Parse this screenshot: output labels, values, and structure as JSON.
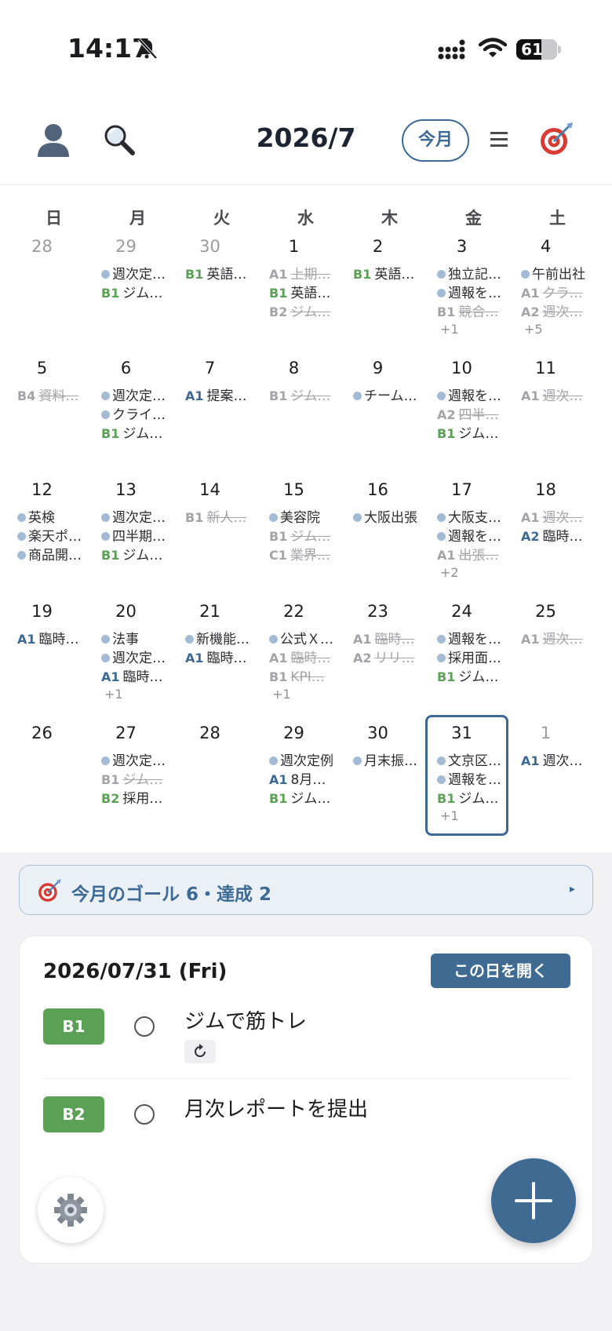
{
  "status_bar": {
    "time": "14:17",
    "battery": "61",
    "battery_level": 0.61
  },
  "header": {
    "month_title": "2026/7",
    "today_label": "今月"
  },
  "weekdays": [
    "日",
    "月",
    "火",
    "水",
    "木",
    "金",
    "土"
  ],
  "calendar": {
    "days": [
      {
        "num": "28",
        "muted": true,
        "events": []
      },
      {
        "num": "29",
        "muted": true,
        "events": [
          {
            "text": "週次定…"
          },
          {
            "tag": "B1",
            "text": "ジム…"
          }
        ]
      },
      {
        "num": "30",
        "muted": true,
        "events": [
          {
            "tag": "B1",
            "text": "英語…"
          }
        ]
      },
      {
        "num": "1",
        "events": [
          {
            "tag": "A1",
            "text": "上期…",
            "done": true
          },
          {
            "tag": "B1",
            "text": "英語…"
          },
          {
            "tag": "B2",
            "text": "ジム…",
            "done": true
          }
        ]
      },
      {
        "num": "2",
        "events": [
          {
            "tag": "B1",
            "text": "英語…"
          }
        ]
      },
      {
        "num": "3",
        "events": [
          {
            "text": "独立記…"
          },
          {
            "text": "週報を…"
          },
          {
            "tag": "B1",
            "text": "競合…",
            "done": true
          }
        ],
        "more": "+1"
      },
      {
        "num": "4",
        "events": [
          {
            "text": "午前出社"
          },
          {
            "tag": "A1",
            "text": "クラ…",
            "done": true
          },
          {
            "tag": "A2",
            "text": "週次…",
            "done": true
          }
        ],
        "more": "+5"
      },
      {
        "num": "5",
        "events": [
          {
            "tag": "B4",
            "text": "資料…",
            "done": true
          }
        ]
      },
      {
        "num": "6",
        "events": [
          {
            "text": "週次定…"
          },
          {
            "text": "クライ…"
          },
          {
            "tag": "B1",
            "text": "ジム…"
          }
        ]
      },
      {
        "num": "7",
        "events": [
          {
            "tag": "A1",
            "text": "提案…"
          }
        ]
      },
      {
        "num": "8",
        "events": [
          {
            "tag": "B1",
            "text": "ジム…",
            "done": true
          }
        ]
      },
      {
        "num": "9",
        "events": [
          {
            "text": "チーム…"
          }
        ]
      },
      {
        "num": "10",
        "events": [
          {
            "text": "週報を…"
          },
          {
            "tag": "A2",
            "text": "四半…",
            "done": true
          },
          {
            "tag": "B1",
            "text": "ジム…"
          }
        ]
      },
      {
        "num": "11",
        "events": [
          {
            "tag": "A1",
            "text": "週次…",
            "done": true
          }
        ]
      },
      {
        "num": "12",
        "events": [
          {
            "text": "英検"
          },
          {
            "text": "楽天ポ…"
          },
          {
            "text": "商品開…"
          }
        ]
      },
      {
        "num": "13",
        "events": [
          {
            "text": "週次定…"
          },
          {
            "text": "四半期…"
          },
          {
            "tag": "B1",
            "text": "ジム…"
          }
        ]
      },
      {
        "num": "14",
        "events": [
          {
            "tag": "B1",
            "text": "新人…",
            "done": true
          }
        ]
      },
      {
        "num": "15",
        "events": [
          {
            "text": "美容院"
          },
          {
            "tag": "B1",
            "text": "ジム…",
            "done": true
          },
          {
            "tag": "C1",
            "text": "業界…",
            "done": true
          }
        ]
      },
      {
        "num": "16",
        "events": [
          {
            "text": "大阪出張"
          }
        ]
      },
      {
        "num": "17",
        "events": [
          {
            "text": "大阪支…"
          },
          {
            "text": "週報を…"
          },
          {
            "tag": "A1",
            "text": "出張…",
            "done": true
          }
        ],
        "more": "+2"
      },
      {
        "num": "18",
        "events": [
          {
            "tag": "A1",
            "text": "週次…",
            "done": true
          },
          {
            "tag": "A2",
            "text": "臨時…"
          }
        ]
      },
      {
        "num": "19",
        "events": [
          {
            "tag": "A1",
            "text": "臨時…"
          }
        ]
      },
      {
        "num": "20",
        "events": [
          {
            "text": "法事"
          },
          {
            "text": "週次定…"
          },
          {
            "tag": "A1",
            "text": "臨時…"
          }
        ],
        "more": "+1"
      },
      {
        "num": "21",
        "events": [
          {
            "text": "新機能…"
          },
          {
            "tag": "A1",
            "text": "臨時…"
          }
        ]
      },
      {
        "num": "22",
        "events": [
          {
            "text": "公式Ｘ…"
          },
          {
            "tag": "A1",
            "text": "臨時…",
            "done": true
          },
          {
            "tag": "B1",
            "text": "KPI…",
            "done": true
          }
        ],
        "more": "+1"
      },
      {
        "num": "23",
        "events": [
          {
            "tag": "A1",
            "text": "臨時…",
            "done": true
          },
          {
            "tag": "A2",
            "text": "リリ…",
            "done": true
          }
        ]
      },
      {
        "num": "24",
        "events": [
          {
            "text": "週報を…"
          },
          {
            "text": "採用面…"
          },
          {
            "tag": "B1",
            "text": "ジム…"
          }
        ]
      },
      {
        "num": "25",
        "events": [
          {
            "tag": "A1",
            "text": "週次…",
            "done": true
          }
        ]
      },
      {
        "num": "26",
        "events": []
      },
      {
        "num": "27",
        "events": [
          {
            "text": "週次定…"
          },
          {
            "tag": "B1",
            "text": "ジム…",
            "done": true
          },
          {
            "tag": "B2",
            "text": "採用…"
          }
        ]
      },
      {
        "num": "28",
        "events": []
      },
      {
        "num": "29",
        "events": [
          {
            "text": "週次定例"
          },
          {
            "tag": "A1",
            "text": "8月…"
          },
          {
            "tag": "B1",
            "text": "ジム…"
          }
        ]
      },
      {
        "num": "30",
        "events": [
          {
            "text": "月末振…"
          }
        ]
      },
      {
        "num": "31",
        "today": true,
        "events": [
          {
            "text": "文京区…"
          },
          {
            "text": "週報を…"
          },
          {
            "tag": "B1",
            "text": "ジム…"
          }
        ],
        "more": "+1"
      },
      {
        "num": "1",
        "muted": true,
        "events": [
          {
            "tag": "A1",
            "text": "週次…"
          }
        ]
      }
    ]
  },
  "goal_bar": {
    "text": "今月のゴール 6・達成 2",
    "arrow": "▸"
  },
  "day_panel": {
    "date": "2026/07/31 (Fri)",
    "open_label": "この日を開く",
    "tasks": [
      {
        "tag": "B1",
        "title": "ジムで筋トレ",
        "repeat": true
      },
      {
        "tag": "B2",
        "title": "月次レポートを提出",
        "repeat": false
      }
    ]
  },
  "colors": {
    "accent": "#3f6a92",
    "tag_a": "#3d6a95",
    "tag_b": "#5aa155",
    "dot": "#a4bbd6"
  },
  "icons": {
    "avatar": "person-silhouette-icon",
    "search": "magnifier-icon",
    "menu": "hamburger-icon",
    "goal": "dart-target-icon",
    "settings": "gear-icon",
    "add": "plus-icon",
    "repeat": "repeat-icon"
  }
}
